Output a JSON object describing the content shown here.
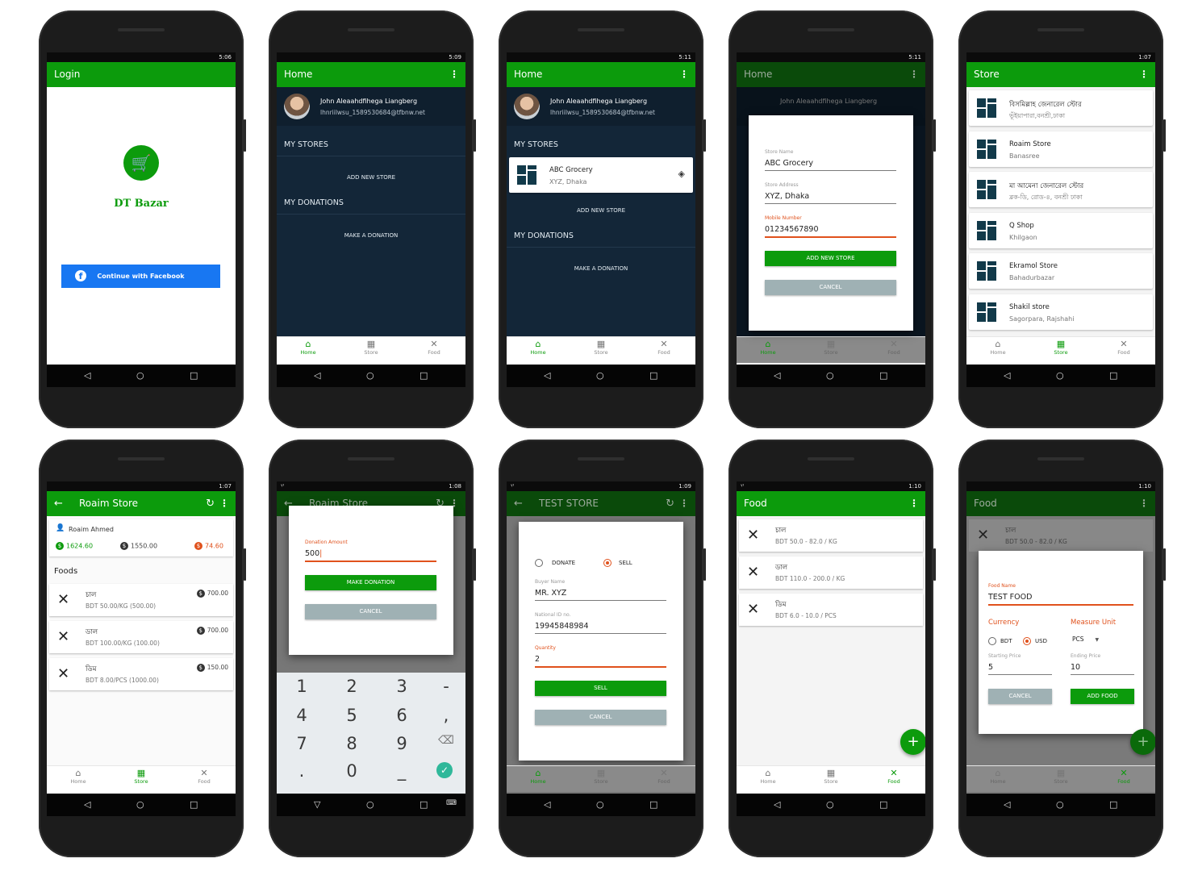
{
  "status_times": [
    "5:06",
    "5:09",
    "5:11",
    "5:11",
    "1:07",
    "1:07",
    "1:08",
    "1:09",
    "1:10",
    "1:10"
  ],
  "login": {
    "title": "Login",
    "brand": "DT Bazar",
    "facebook_button": "Continue with Facebook"
  },
  "home": {
    "title": "Home",
    "user_name": "John Aleaahdfihega Liangberg",
    "user_email": "lhnriilwsu_1589530684@tfbnw.net",
    "my_stores": "MY STORES",
    "add_store": "ADD NEW STORE",
    "my_donations": "MY DONATIONS",
    "make_donation": "MAKE A DONATION",
    "store_item": {
      "name": "ABC Grocery",
      "address": "XYZ, Dhaka"
    }
  },
  "nav": {
    "home": "Home",
    "store": "Store",
    "food": "Food"
  },
  "add_store_dialog": {
    "name_label": "Store Name",
    "name_value": "ABC Grocery",
    "address_label": "Store Address",
    "address_value": "XYZ, Dhaka",
    "mobile_label": "Mobile Number",
    "mobile_value": "01234567890",
    "add_button": "ADD NEW STORE",
    "cancel_button": "CANCEL"
  },
  "store_list": {
    "title": "Store",
    "items": [
      {
        "name": "বিসমিল্লাহ জেনারেল স্টোর",
        "address": "ভূঁইয়াপারা,বনশ্রী,ঢাকা"
      },
      {
        "name": "Roaim Store",
        "address": "Banasree"
      },
      {
        "name": "মা আমেনা জেনারেল স্টোর",
        "address": "ব্লক-ডি, রোড-৪, বনশ্রী ঢাকা"
      },
      {
        "name": "Q Shop",
        "address": "Khilgaon"
      },
      {
        "name": "Ekramol Store",
        "address": "Bahadurbazar"
      },
      {
        "name": "Shakil store",
        "address": "Sagorpara, Rajshahi"
      }
    ]
  },
  "store_detail": {
    "title": "Roaim Store",
    "owner": "Roaim Ahmed",
    "stats": [
      "1624.60",
      "1550.00",
      "74.60"
    ],
    "foods_heading": "Foods",
    "foods": [
      {
        "name": "চাল",
        "detail": "BDT 50.00/KG (500.00)",
        "price": "700.00"
      },
      {
        "name": "ডাল",
        "detail": "BDT 100.00/KG (100.00)",
        "price": "700.00"
      },
      {
        "name": "ডিম",
        "detail": "BDT 8.00/PCS (1000.00)",
        "price": "150.00"
      }
    ]
  },
  "donation_dialog": {
    "label": "Donation Amount",
    "value": "500",
    "make_button": "MAKE DONATION",
    "cancel_button": "CANCEL",
    "keys": [
      "1",
      "2",
      "3",
      "-",
      "4",
      "5",
      "6",
      ",",
      "7",
      "8",
      "9",
      ".",
      "0",
      "_"
    ]
  },
  "sell_dialog": {
    "store_title": "TEST STORE",
    "donate": "DONATE",
    "sell": "SELL",
    "buyer_label": "Buyer Name",
    "buyer_value": "MR. XYZ",
    "nid_label": "National ID no.",
    "nid_value": "19945848984",
    "qty_label": "Quantity",
    "qty_value": "2",
    "sell_button": "SELL",
    "cancel_button": "CANCEL"
  },
  "food_list": {
    "title": "Food",
    "items": [
      {
        "name": "চাল",
        "detail": "BDT 50.0 - 82.0 / KG"
      },
      {
        "name": "ডাল",
        "detail": "BDT 110.0 - 200.0 / KG"
      },
      {
        "name": "ডিম",
        "detail": "BDT 6.0 - 10.0 / PCS"
      }
    ]
  },
  "add_food_dialog": {
    "name_label": "Food Name",
    "name_value": "TEST FOOD",
    "currency_label": "Currency",
    "measure_label": "Measure Unit",
    "bdt": "BDT",
    "usd": "USD",
    "unit": "PCS",
    "start_label": "Starting Price",
    "start_value": "5",
    "end_label": "Ending Price",
    "end_value": "10",
    "cancel_button": "CANCEL",
    "add_button": "ADD FOOD"
  },
  "colors": {
    "primary": "#0c9b0c",
    "accent": "#e0511c",
    "dark": "#132638",
    "facebook": "#1877f2"
  }
}
